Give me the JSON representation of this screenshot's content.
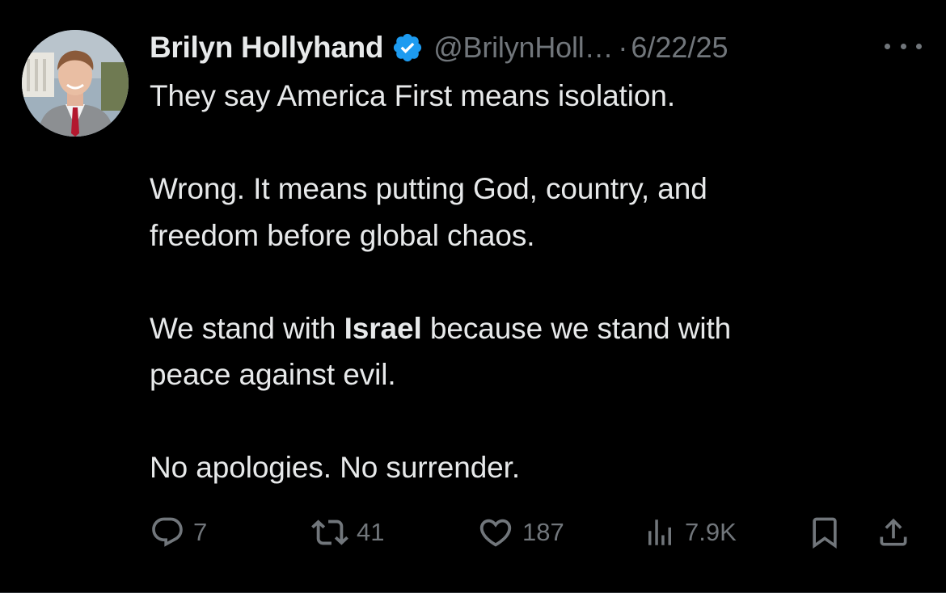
{
  "author": {
    "display_name": "Brilyn Hollyhand",
    "handle": "@BrilynHoll…",
    "separator": "·",
    "date": "6/22/25"
  },
  "icons": {
    "verified": "verified-badge-icon",
    "more": "more-options-icon",
    "reply": "reply-icon",
    "retweet": "retweet-icon",
    "like": "heart-icon",
    "views": "views-bar-chart-icon",
    "bookmark": "bookmark-icon",
    "share": "share-icon"
  },
  "colors": {
    "background": "#000000",
    "text": "#e7e9ea",
    "muted": "#71767b",
    "verified": "#1d9bf0"
  },
  "tweet": {
    "line1": "They say America First means isolation.",
    "para2_line1": "Wrong. It means putting God, country, and",
    "para2_line2": "freedom before global chaos.",
    "para3_pre": "We stand with ",
    "para3_bold": "Israel",
    "para3_post": " because we stand with",
    "para3_line2": "peace against evil.",
    "para4": "No apologies. No surrender."
  },
  "metrics": {
    "replies": "7",
    "retweets": "41",
    "likes": "187",
    "views": "7.9K"
  }
}
